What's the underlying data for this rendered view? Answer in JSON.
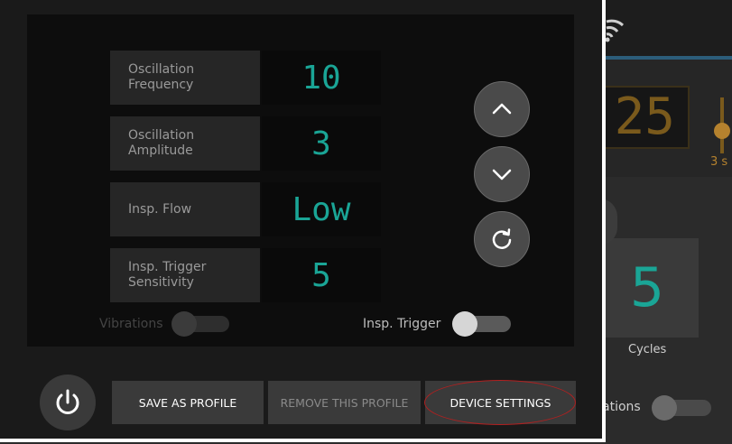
{
  "background_app": {
    "counter_value": "25",
    "slider_value": "3 s",
    "cycles_value": "5",
    "cycles_label": "Cycles",
    "vibrations_label_partial": "ations"
  },
  "settings": {
    "rows": [
      {
        "label": "Oscillation\nFrequency",
        "value": "10"
      },
      {
        "label": "Oscillation\nAmplitude",
        "value": "3"
      },
      {
        "label": "Insp. Flow",
        "value": "Low"
      },
      {
        "label": "Insp. Trigger\nSensitivity",
        "value": "5"
      }
    ],
    "vibrations_label": "Vibrations",
    "insp_trigger_label": "Insp. Trigger"
  },
  "actions": {
    "save_profile": "SAVE AS PROFILE",
    "remove_profile": "REMOVE THIS PROFILE",
    "device_settings": "DEVICE SETTINGS"
  },
  "colors": {
    "accent_teal": "#1aa596",
    "highlight_red": "#b02020",
    "amber": "#b5822e"
  },
  "icons": {
    "up": "chevron-up-icon",
    "down": "chevron-down-icon",
    "reset": "refresh-icon",
    "power": "power-icon",
    "wifi": "wifi-icon",
    "collapse": "collapse-left-icon"
  }
}
